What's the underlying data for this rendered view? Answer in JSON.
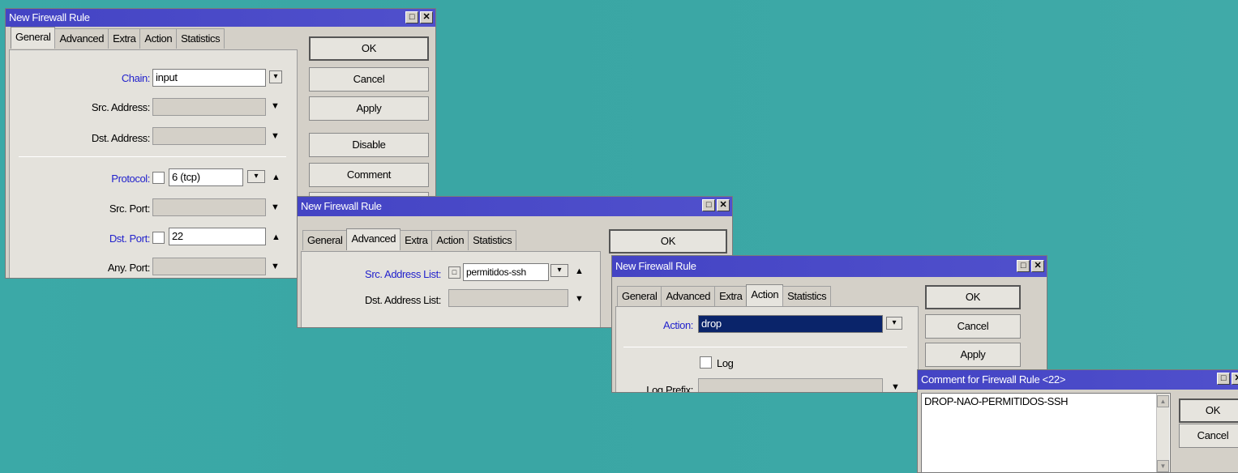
{
  "win1": {
    "title": "New Firewall Rule",
    "tabs": [
      "General",
      "Advanced",
      "Extra",
      "Action",
      "Statistics"
    ],
    "labels": {
      "chain": "Chain:",
      "src_address": "Src. Address:",
      "dst_address": "Dst. Address:",
      "protocol": "Protocol:",
      "src_port": "Src. Port:",
      "dst_port": "Dst. Port:",
      "any_port": "Any. Port:"
    },
    "values": {
      "chain": "input",
      "protocol": "6 (tcp)",
      "dst_port": "22"
    },
    "buttons": [
      "OK",
      "Cancel",
      "Apply",
      "Disable",
      "Comment"
    ]
  },
  "win2": {
    "title": "New Firewall Rule",
    "tabs": [
      "General",
      "Advanced",
      "Extra",
      "Action",
      "Statistics"
    ],
    "labels": {
      "src_address_list": "Src. Address List:",
      "dst_address_list": "Dst. Address List:"
    },
    "values": {
      "src_address_list": "permitidos-ssh"
    },
    "buttons": [
      "OK"
    ]
  },
  "win3": {
    "title": "New Firewall Rule",
    "tabs": [
      "General",
      "Advanced",
      "Extra",
      "Action",
      "Statistics"
    ],
    "labels": {
      "action": "Action:",
      "log": "Log",
      "log_prefix": "Log Prefix:"
    },
    "values": {
      "action": "drop"
    },
    "buttons": [
      "OK",
      "Cancel",
      "Apply"
    ]
  },
  "win4": {
    "title": "Comment for Firewall Rule <22>",
    "comment": "DROP-NAO-PERMITIDOS-SSH",
    "buttons": [
      "OK",
      "Cancel"
    ]
  },
  "icons": {
    "maximize": "□",
    "close": "✕",
    "dropdown": "▾",
    "down": "▼",
    "up": "▲",
    "scroll_up": "▲",
    "scroll_down": "▼"
  },
  "colors": {
    "titlebar": "#4b4bc0",
    "window": "#d4d0c8",
    "desktop": "#3aa8a6",
    "blue_label": "#2222cc",
    "selection": "#0a246a"
  }
}
